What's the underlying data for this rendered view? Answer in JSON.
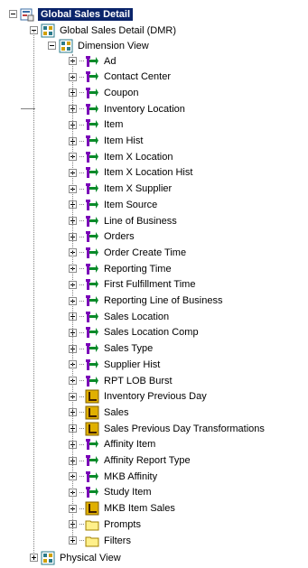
{
  "tree": {
    "root": {
      "label": "Global Sales Detail",
      "icon": "report-package-icon",
      "expanded": true
    },
    "dmr": {
      "label": "Global Sales Detail (DMR)",
      "icon": "namespace-icon",
      "expanded": true
    },
    "dimension_view": {
      "label": "Dimension View",
      "icon": "namespace-icon",
      "expanded": true
    },
    "children": [
      {
        "label": "Ad",
        "icon": "dimension-icon"
      },
      {
        "label": "Contact Center",
        "icon": "dimension-icon"
      },
      {
        "label": "Coupon",
        "icon": "dimension-icon"
      },
      {
        "label": "Inventory Location",
        "icon": "dimension-icon"
      },
      {
        "label": "Item",
        "icon": "dimension-icon"
      },
      {
        "label": "Item Hist",
        "icon": "dimension-icon"
      },
      {
        "label": "Item X Location",
        "icon": "dimension-icon"
      },
      {
        "label": "Item X Location Hist",
        "icon": "dimension-icon"
      },
      {
        "label": "Item X Supplier",
        "icon": "dimension-icon"
      },
      {
        "label": "Item Source",
        "icon": "dimension-icon"
      },
      {
        "label": "Line of Business",
        "icon": "dimension-icon"
      },
      {
        "label": "Orders",
        "icon": "dimension-icon"
      },
      {
        "label": "Order Create Time",
        "icon": "dimension-icon"
      },
      {
        "label": "Reporting Time",
        "icon": "dimension-icon"
      },
      {
        "label": "First Fulfillment Time",
        "icon": "dimension-icon"
      },
      {
        "label": "Reporting Line of Business",
        "icon": "dimension-icon"
      },
      {
        "label": "Sales Location",
        "icon": "dimension-icon"
      },
      {
        "label": "Sales Location Comp",
        "icon": "dimension-icon"
      },
      {
        "label": "Sales Type",
        "icon": "dimension-icon"
      },
      {
        "label": "Supplier Hist",
        "icon": "dimension-icon"
      },
      {
        "label": "RPT LOB Burst",
        "icon": "dimension-icon"
      },
      {
        "label": "Inventory Previous Day",
        "icon": "measure-dimension-icon"
      },
      {
        "label": "Sales",
        "icon": "measure-dimension-icon"
      },
      {
        "label": "Sales Previous Day Transformations",
        "icon": "measure-dimension-icon"
      },
      {
        "label": "Affinity Item",
        "icon": "dimension-icon"
      },
      {
        "label": "Affinity Report Type",
        "icon": "dimension-icon"
      },
      {
        "label": "MKB Affinity",
        "icon": "dimension-icon"
      },
      {
        "label": "Study Item",
        "icon": "dimension-icon"
      },
      {
        "label": "MKB Item Sales",
        "icon": "measure-dimension-icon"
      },
      {
        "label": "Prompts",
        "icon": "folder-icon"
      },
      {
        "label": "Filters",
        "icon": "folder-icon"
      }
    ],
    "physical_view": {
      "label": "Physical View",
      "icon": "namespace-icon",
      "expanded": false
    }
  },
  "colors": {
    "selection": "#0a246a",
    "dimension_arrow": "#7a00b8",
    "dimension_dot": "#0a8a2a",
    "measure_gold": "#e0b000",
    "folder_yellow": "#fff08a",
    "namespace_teal": "#2a7a8a"
  }
}
